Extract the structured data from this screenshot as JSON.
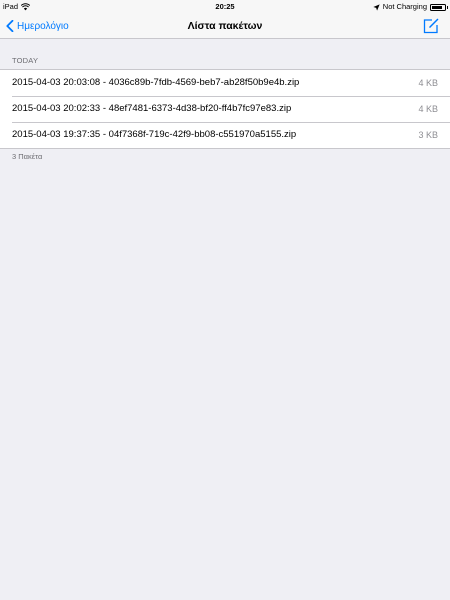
{
  "status_bar": {
    "device": "iPad",
    "time": "20:25",
    "charging": "Not Charging",
    "battery_level": 0.85
  },
  "nav_bar": {
    "back_label": "Ημερολόγιο",
    "title": "Λίστα πακέτων",
    "accent_color": "#007aff"
  },
  "list": {
    "section_header": "TODAY",
    "rows": [
      {
        "name": "2015-04-03 20:03:08 - 4036c89b-7fdb-4569-beb7-ab28f50b9e4b.zip",
        "size": "4 KB"
      },
      {
        "name": "2015-04-03 20:02:33 - 48ef7481-6373-4d38-bf20-ff4b7fc97e83.zip",
        "size": "4 KB"
      },
      {
        "name": "2015-04-03 19:37:35 - 04f7368f-719c-42f9-bb08-c551970a5155.zip",
        "size": "3 KB"
      }
    ],
    "footer": "3 Πακέτα"
  }
}
